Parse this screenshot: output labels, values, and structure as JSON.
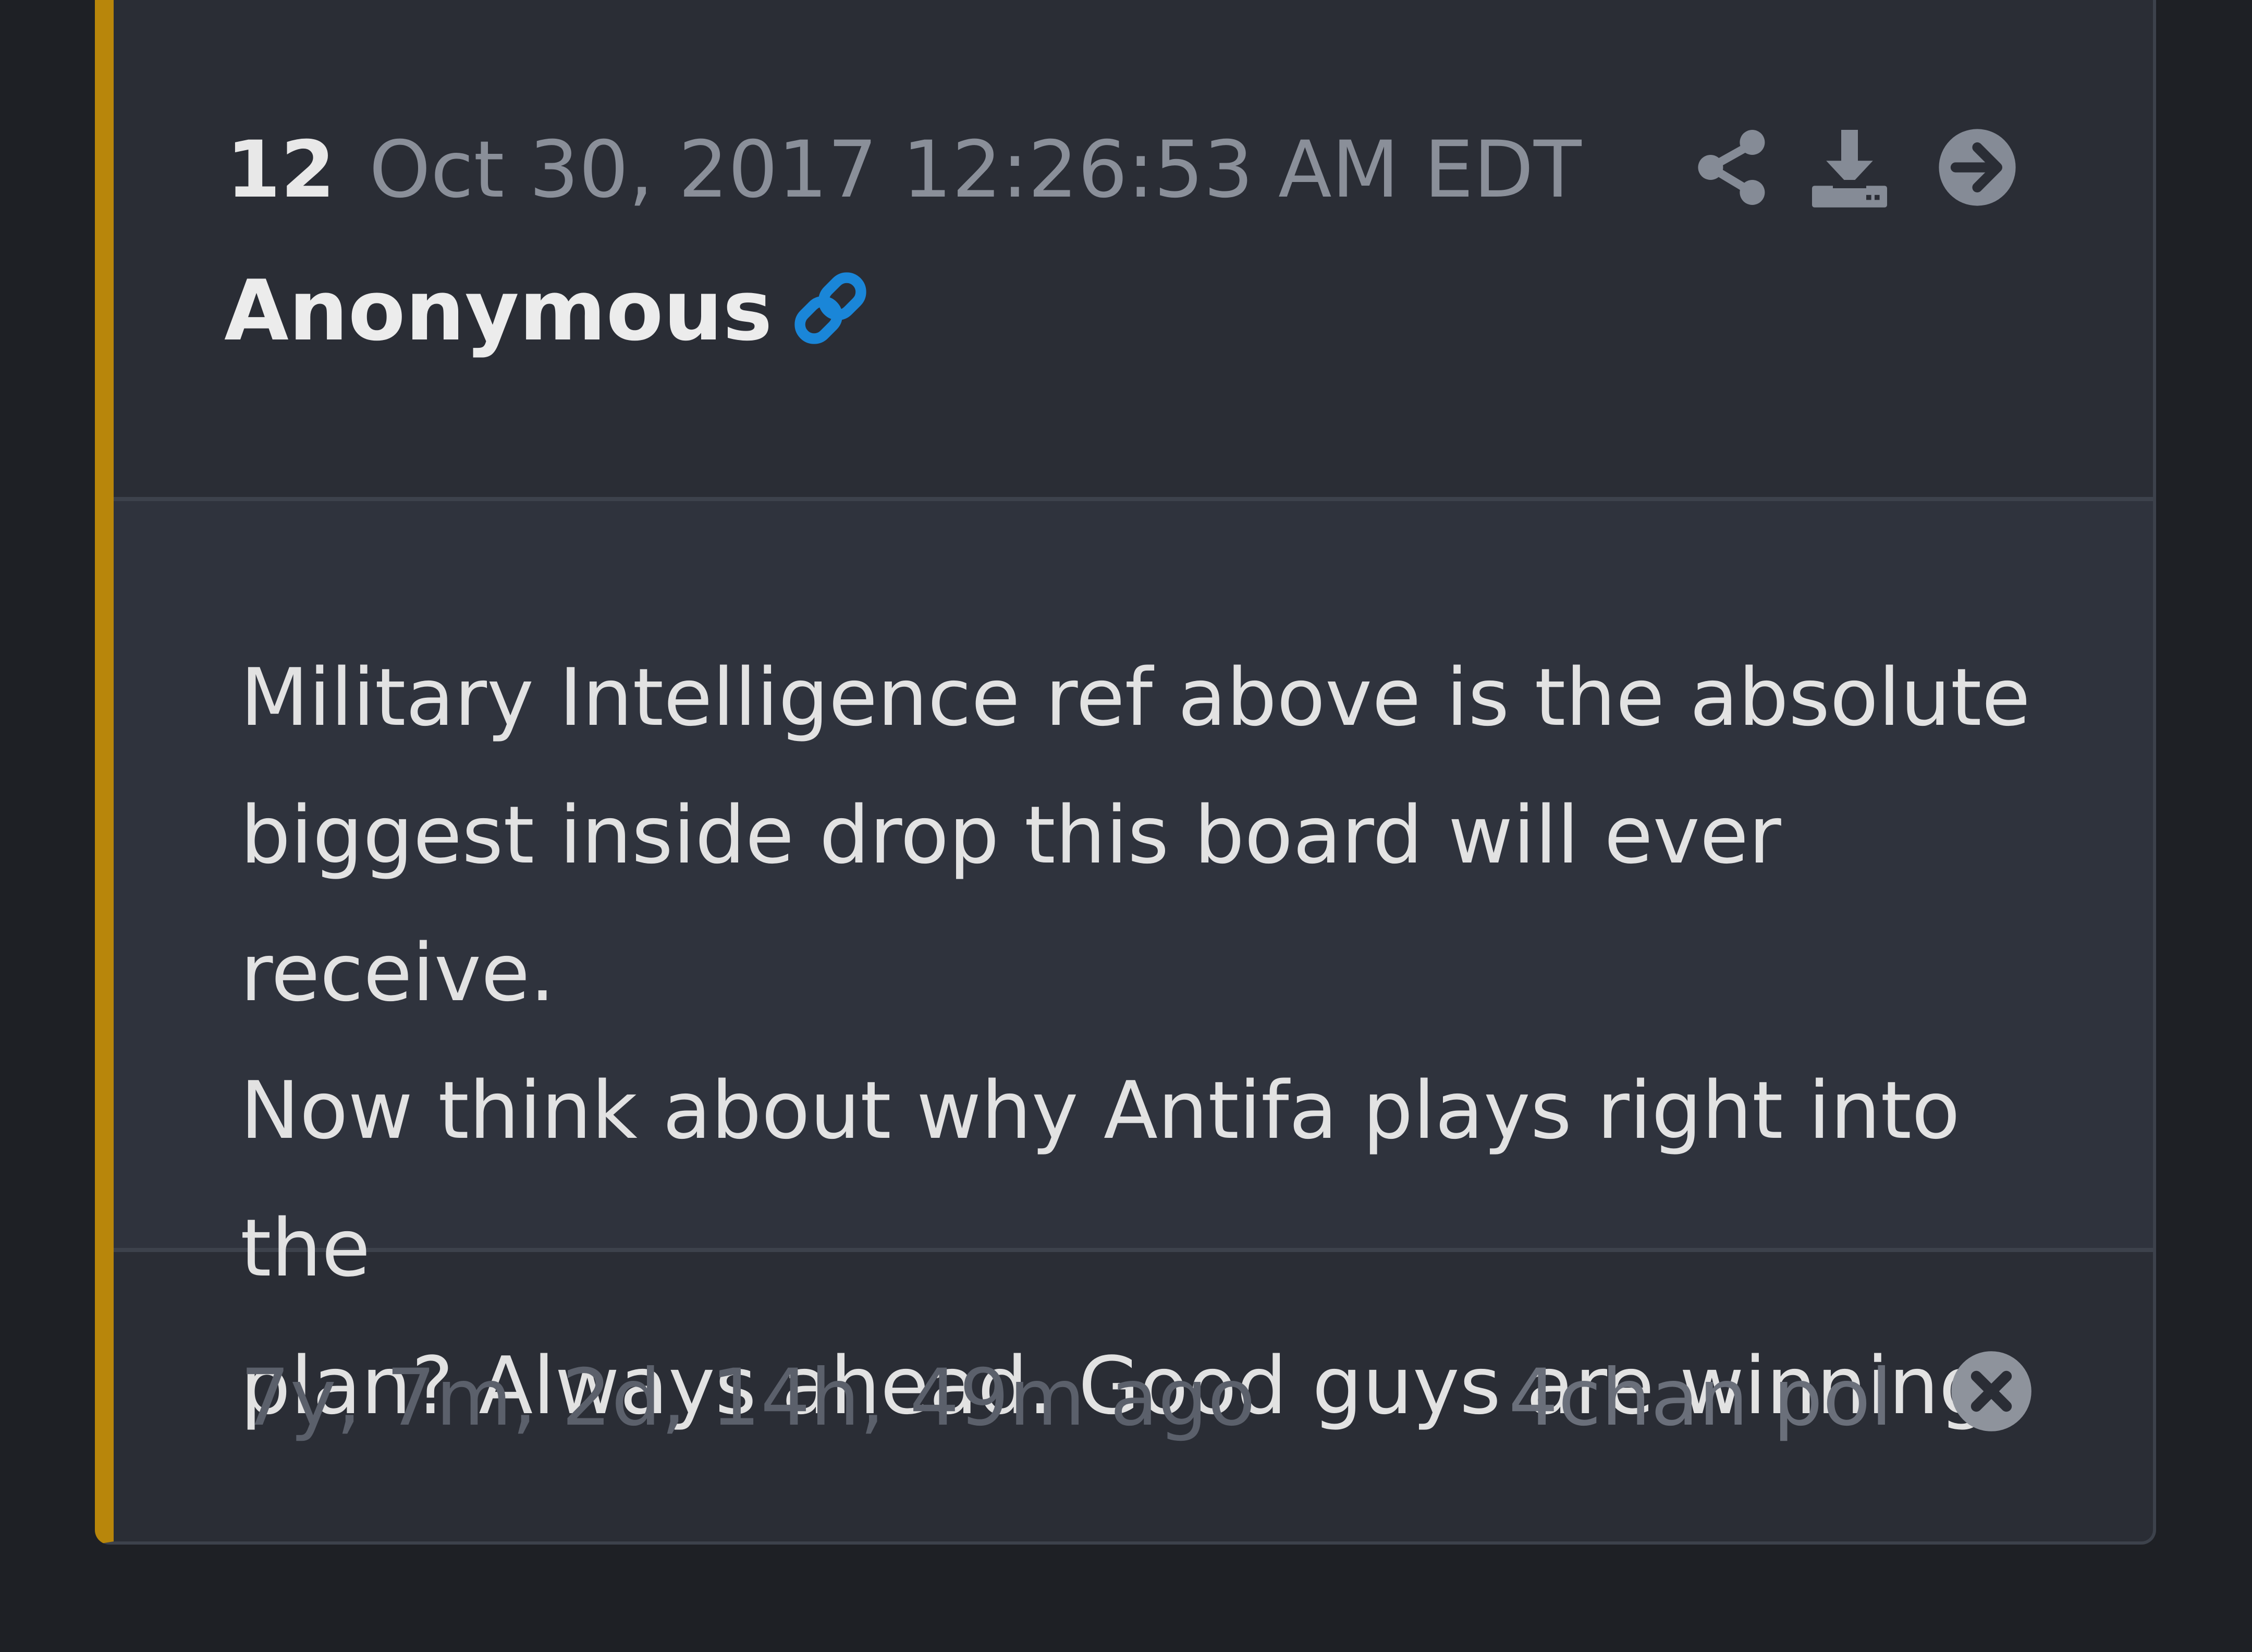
{
  "post": {
    "number": "12",
    "date": "Oct 30, 2017 12:26:53 AM EDT",
    "author": "Anonymous",
    "body_lines": [
      "Military Intelligence ref above is the absolute",
      "biggest inside drop this board will ever receive.",
      "Now think about why Antifa plays right into the",
      "plan? Always ahead. Good guys are winning."
    ],
    "time_ago": "7y, 7m, 2d, 14h, 49m ago",
    "source": "4chan pol"
  },
  "icons": {
    "link": "link-icon",
    "share": "share-icon",
    "download": "download-icon",
    "next": "arrow-right-circle-icon",
    "close": "close-circle-icon"
  },
  "colors": {
    "accent": "#b8860b",
    "link": "#1a86d8",
    "card_bg": "#2a2d35",
    "body_bg": "#2f333d",
    "page_bg": "#1e2025"
  }
}
